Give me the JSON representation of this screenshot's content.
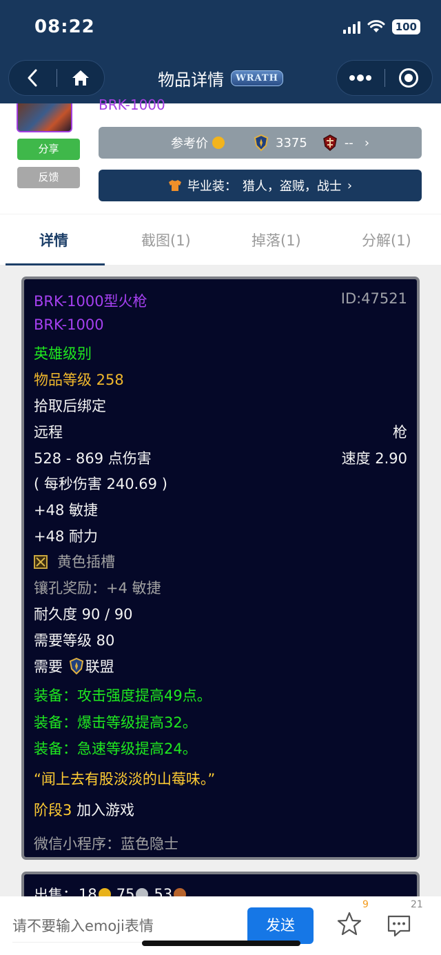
{
  "status": {
    "time": "08:22",
    "battery": "100"
  },
  "nav": {
    "title": "物品详情",
    "badge": "WRATH"
  },
  "item_header": {
    "name": "BRK-1000",
    "share_label": "分享",
    "feedback_label": "反馈",
    "price_label": "参考价",
    "alliance_price": "3375",
    "horde_price": "--",
    "bis_label": "毕业装：",
    "bis_classes": "猎人，盗贼，战士"
  },
  "tabs": [
    {
      "label": "详情"
    },
    {
      "label": "截图(1)"
    },
    {
      "label": "掉落(1)"
    },
    {
      "label": "分解(1)"
    }
  ],
  "tooltip": {
    "name": "BRK-1000型火枪",
    "id": "ID:47521",
    "subname": "BRK-1000",
    "quality": "英雄级别",
    "item_level": "物品等级 258",
    "bind": "拾取后绑定",
    "slot": "远程",
    "type": "枪",
    "damage": "528 - 869 点伤害",
    "speed": "速度 2.90",
    "dps": "( 每秒伤害 240.69 )",
    "stat1": "+48 敏捷",
    "stat2": "+48 耐力",
    "socket": "黄色插槽",
    "socket_bonus": "镶孔奖励：+4 敏捷",
    "durability": "耐久度 90 / 90",
    "req_level": "需要等级 80",
    "req_faction_prefix": "需要",
    "req_faction": "联盟",
    "equip1": "装备：攻击强度提高49点。",
    "equip2": "装备：爆击等级提高32。",
    "equip3": "装备：急速等级提高24。",
    "flavor": "“闻上去有股淡淡的山莓味。”",
    "phase_label": "阶段3",
    "phase_text": "加入游戏",
    "source": "微信小程序：蓝色隐士"
  },
  "sell": {
    "label": "出售：",
    "gold": "18",
    "silver": "75",
    "copper": "53"
  },
  "comment": {
    "placeholder": "请不要输入emoji表情",
    "send_label": "发送",
    "favorite_count": "9",
    "comment_count": "21"
  }
}
